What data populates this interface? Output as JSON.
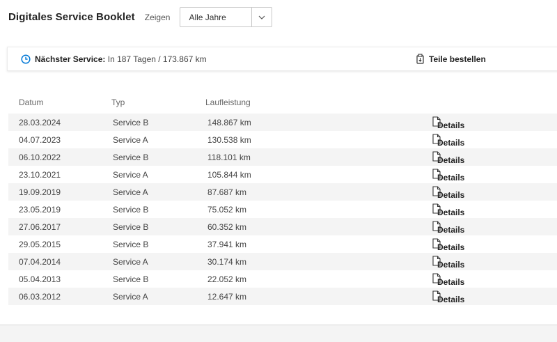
{
  "header": {
    "title": "Digitales Service Booklet",
    "show_label": "Zeigen",
    "year_select": {
      "value": "Alle Jahre"
    }
  },
  "next_service": {
    "label": "Nächster Service:",
    "value": "In 187 Tagen / 173.867 km",
    "order_label": "Teile bestellen",
    "icons": {
      "clock": "clock-icon",
      "order": "parts-order-icon"
    },
    "accent_color": "#0078d6"
  },
  "table": {
    "columns": {
      "date": "Datum",
      "type": "Typ",
      "mileage": "Laufleistung"
    },
    "details_label": "Details",
    "rows": [
      {
        "date": "28.03.2024",
        "type": "Service B",
        "mileage": "148.867 km"
      },
      {
        "date": "04.07.2023",
        "type": "Service A",
        "mileage": "130.538 km"
      },
      {
        "date": "06.10.2022",
        "type": "Service B",
        "mileage": "118.101 km"
      },
      {
        "date": "23.10.2021",
        "type": "Service A",
        "mileage": "105.844 km"
      },
      {
        "date": "19.09.2019",
        "type": "Service A",
        "mileage": "87.687 km"
      },
      {
        "date": "23.05.2019",
        "type": "Service B",
        "mileage": "75.052 km"
      },
      {
        "date": "27.06.2017",
        "type": "Service B",
        "mileage": "60.352 km"
      },
      {
        "date": "29.05.2015",
        "type": "Service B",
        "mileage": "37.941 km"
      },
      {
        "date": "07.04.2014",
        "type": "Service A",
        "mileage": "30.174 km"
      },
      {
        "date": "05.04.2013",
        "type": "Service B",
        "mileage": "22.052 km"
      },
      {
        "date": "06.03.2012",
        "type": "Service A",
        "mileage": "12.647 km"
      }
    ]
  }
}
